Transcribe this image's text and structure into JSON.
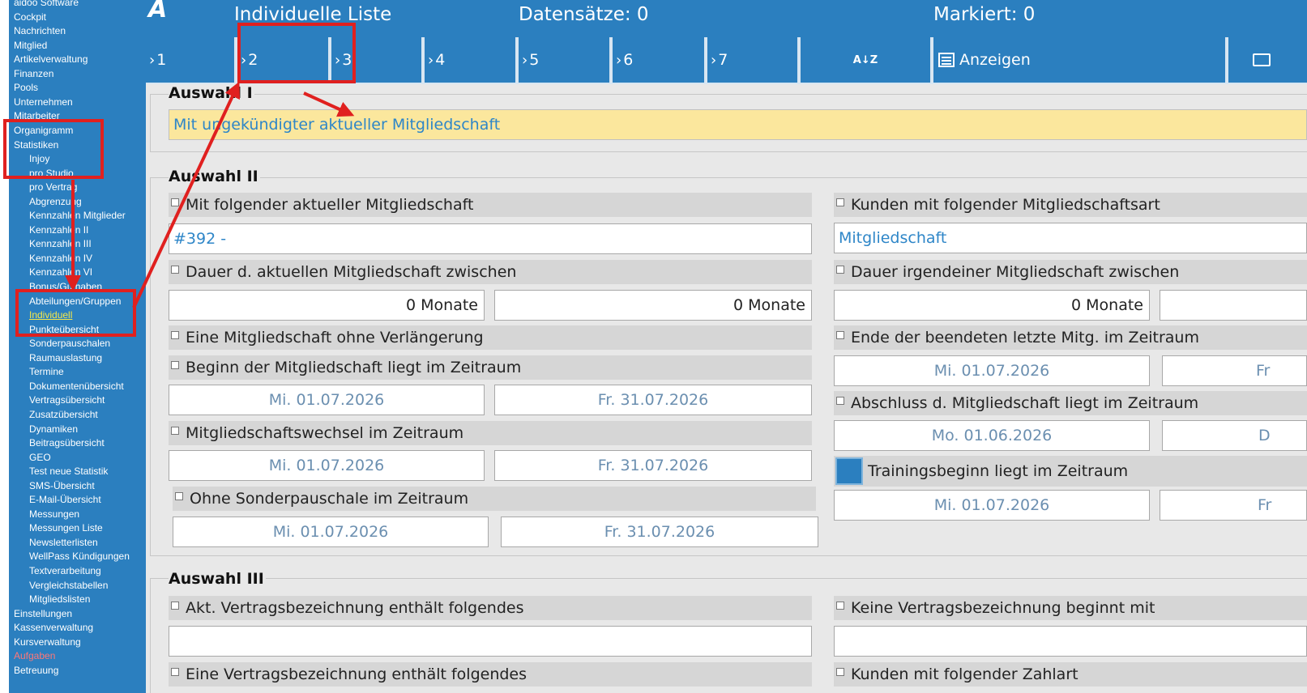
{
  "sidebar": {
    "items": [
      {
        "label": "aidoo Software",
        "level": 0
      },
      {
        "label": "Cockpit",
        "level": 0
      },
      {
        "label": "Nachrichten",
        "level": 0
      },
      {
        "label": "Mitglied",
        "level": 0
      },
      {
        "label": "Artikelverwaltung",
        "level": 0
      },
      {
        "label": "Finanzen",
        "level": 0
      },
      {
        "label": "Pools",
        "level": 0
      },
      {
        "label": "Unternehmen",
        "level": 0
      },
      {
        "label": "Mitarbeiter",
        "level": 0
      },
      {
        "label": "Organigramm",
        "level": 0
      },
      {
        "label": "Statistiken",
        "level": 0
      },
      {
        "label": "Injoy",
        "level": 1
      },
      {
        "label": "pro Studio",
        "level": 1
      },
      {
        "label": "pro Vertrag",
        "level": 1
      },
      {
        "label": "Abgrenzung",
        "level": 1
      },
      {
        "label": "Kennzahlen Mitglieder",
        "level": 1
      },
      {
        "label": "Kennzahlen II",
        "level": 1
      },
      {
        "label": "Kennzahlen III",
        "level": 1
      },
      {
        "label": "Kennzahlen IV",
        "level": 1
      },
      {
        "label": "Kennzahlen VI",
        "level": 1
      },
      {
        "label": "Bonus/Guthaben",
        "level": 1
      },
      {
        "label": "Abteilungen/Gruppen",
        "level": 1
      },
      {
        "label": "Individuell",
        "level": 1,
        "active": true
      },
      {
        "label": "Punkteübersicht",
        "level": 1
      },
      {
        "label": "Sonderpauschalen",
        "level": 1
      },
      {
        "label": "Raumauslastung",
        "level": 1
      },
      {
        "label": "Termine",
        "level": 1
      },
      {
        "label": "Dokumentenübersicht",
        "level": 1
      },
      {
        "label": "Vertragsübersicht",
        "level": 1
      },
      {
        "label": "Zusatzübersicht",
        "level": 1
      },
      {
        "label": "Dynamiken",
        "level": 1
      },
      {
        "label": "Beitragsübersicht",
        "level": 1
      },
      {
        "label": "GEO",
        "level": 1
      },
      {
        "label": "Test neue Statistik",
        "level": 1
      },
      {
        "label": "SMS-Übersicht",
        "level": 1
      },
      {
        "label": "E-Mail-Übersicht",
        "level": 1
      },
      {
        "label": "Messungen",
        "level": 1
      },
      {
        "label": "Messungen Liste",
        "level": 1
      },
      {
        "label": "Newsletterlisten",
        "level": 1
      },
      {
        "label": "WellPass Kündigungen",
        "level": 1
      },
      {
        "label": "Textverarbeitung",
        "level": 1
      },
      {
        "label": "Vergleichstabellen",
        "level": 1
      },
      {
        "label": "Mitgliedslisten",
        "level": 1
      },
      {
        "label": "Einstellungen",
        "level": 0
      },
      {
        "label": "Kassenverwaltung",
        "level": 0
      },
      {
        "label": "Kursverwaltung",
        "level": 0
      },
      {
        "label": "Aufgaben",
        "level": 0,
        "alert": true
      },
      {
        "label": "Betreuung",
        "level": 0
      }
    ]
  },
  "header": {
    "logo": "A",
    "title": "Individuelle Liste",
    "records": "Datensätze: 0",
    "marked": "Markiert: 0"
  },
  "toolbar": {
    "tabs": [
      "1",
      "2",
      "3",
      "4",
      "5",
      "6",
      "7"
    ],
    "sort_icon": "A↓Z",
    "show_label": "Anzeigen"
  },
  "auswahl1": {
    "title": "Auswahl I",
    "value": "Mit ungekündigter aktueller Mitgliedschaft"
  },
  "auswahl2": {
    "title": "Auswahl II",
    "left": {
      "current_membership": {
        "label": "Mit folgender aktueller Mitgliedschaft",
        "value": "#392 -"
      },
      "duration": {
        "label": "Dauer d. aktuellen Mitgliedschaft zwischen",
        "from": "0 Monate",
        "to": "0 Monate"
      },
      "no_extension": {
        "label": "Eine Mitgliedschaft ohne Verlängerung"
      },
      "start": {
        "label": "Beginn der Mitgliedschaft liegt im Zeitraum",
        "from": "Mi. 01.07.2026",
        "to": "Fr. 31.07.2026"
      },
      "change": {
        "label": "Mitgliedschaftswechsel im Zeitraum",
        "from": "Mi. 01.07.2026",
        "to": "Fr. 31.07.2026"
      },
      "no_special": {
        "label": "Ohne Sonderpauschale im Zeitraum",
        "from": "Mi. 01.07.2026",
        "to": "Fr. 31.07.2026"
      }
    },
    "right": {
      "membership_type": {
        "label": "Kunden mit folgender Mitgliedschaftsart",
        "value": "Mitgliedschaft"
      },
      "any_duration": {
        "label": "Dauer irgendeiner Mitgliedschaft zwischen",
        "from": "0 Monate"
      },
      "end_last": {
        "label": "Ende der beendeten letzte Mitg. im Zeitraum",
        "from": "Mi. 01.07.2026",
        "to": "Fr"
      },
      "conclusion": {
        "label": "Abschluss d. Mitgliedschaft liegt im Zeitraum",
        "from": "Mo. 01.06.2026",
        "to": "D"
      },
      "training": {
        "label": "Trainingsbeginn liegt im Zeitraum",
        "from": "Mi. 01.07.2026",
        "to": "Fr"
      }
    }
  },
  "auswahl3": {
    "title": "Auswahl III",
    "contract_contains": {
      "label": "Akt. Vertragsbezeichnung enthält folgendes",
      "value": ""
    },
    "no_contract_begins": {
      "label": "Keine Vertragsbezeichnung beginnt mit",
      "value": ""
    },
    "one_contract_contains": {
      "label": "Eine Vertragsbezeichnung enthält folgendes"
    },
    "payment_type": {
      "label": "Kunden mit folgender Zahlart"
    }
  },
  "colors": {
    "primary": "#2b7fbf",
    "highlight": "#fbe79d",
    "annotation": "#e0201f",
    "active_nav": "#f5e84a"
  }
}
